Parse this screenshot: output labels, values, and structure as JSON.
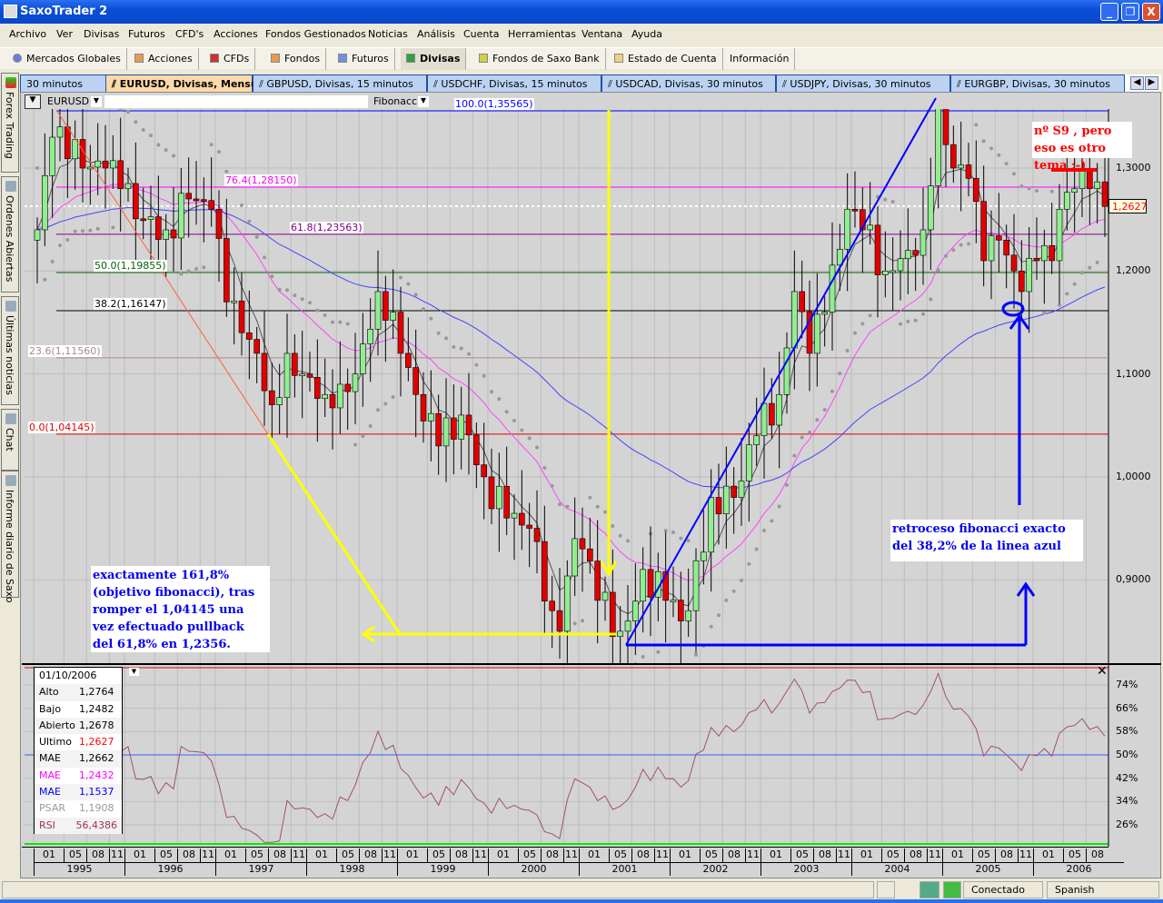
{
  "window": {
    "title": "SaxoTrader 2",
    "min": "_",
    "restore": "❐",
    "close": "X"
  },
  "menu": [
    "Archivo",
    "Ver",
    "Divisas",
    "Futuros",
    "CFD's",
    "Acciones",
    "Fondos Gestionados",
    "Noticias",
    "Análisis",
    "Cuenta",
    "Herramientas",
    "Ventana",
    "Ayuda"
  ],
  "toolbar": [
    "Mercados Globales",
    "Acciones",
    "CFDs",
    "Fondos",
    "Futuros",
    "Divisas",
    "Fondos de Saxo Bank",
    "Estado de Cuenta",
    "Información"
  ],
  "sidebar": [
    "Forex Trading",
    "Ordenes Abiertas",
    "Últimas noticias",
    "Chat",
    "Informe diario de Saxo"
  ],
  "tabs": [
    "30 minutos",
    "EURUSD, Divisas, Mensual",
    "GBPUSD, Divisas, 15 minutos",
    "USDCHF, Divisas, 15 minutos",
    "USDCAD, Divisas, 30 minutos",
    "USDJPY, Divisas, 30 minutos",
    "EURGBP, Divisas, 30 minutos"
  ],
  "chart_header": {
    "symbol": "EURUSD",
    "tool": "Fibonacci"
  },
  "colors": {
    "up": "#90ee90",
    "down": "#e00000",
    "ema_fast": "#555555",
    "ema_mid": "#ff44ff",
    "ema_slow": "#4444ff",
    "psar": "#999999",
    "rsi": "#a05070"
  },
  "chart_data": {
    "type": "candlestick",
    "symbol": "EURUSD",
    "period": "Mensual",
    "ylim": [
      0.8,
      1.37
    ],
    "y_ticks": [
      "1,3000",
      "1,2000",
      "1,1000",
      "1,0000",
      "0,9000"
    ],
    "y_tick_values": [
      1.3,
      1.2,
      1.1,
      1.0,
      0.9
    ],
    "last_price": "1,2627",
    "last_value": 1.2627,
    "month_ticks": [
      "01",
      "05",
      "08",
      "11"
    ],
    "years": [
      "1995",
      "1996",
      "1997",
      "1998",
      "1999",
      "2000",
      "2001",
      "2002",
      "2003",
      "2004",
      "2005",
      "2006"
    ],
    "close_anchors": [
      [
        "1995-01",
        1.24
      ],
      [
        "1995-03",
        1.33
      ],
      [
        "1995-04",
        1.34
      ],
      [
        "1995-07",
        1.3
      ],
      [
        "1995-10",
        1.3
      ],
      [
        "1995-12",
        1.28
      ],
      [
        "1996-03",
        1.25
      ],
      [
        "1996-06",
        1.24
      ],
      [
        "1996-09",
        1.27
      ],
      [
        "1996-12",
        1.26
      ],
      [
        "1997-02",
        1.17
      ],
      [
        "1997-04",
        1.14
      ],
      [
        "1997-06",
        1.12
      ],
      [
        "1997-08",
        1.07
      ],
      [
        "1997-10",
        1.12
      ],
      [
        "1997-12",
        1.1
      ],
      [
        "1998-03",
        1.08
      ],
      [
        "1998-05",
        1.09
      ],
      [
        "1998-07",
        1.1
      ],
      [
        "1998-10",
        1.18
      ],
      [
        "1998-12",
        1.16
      ],
      [
        "1999-01",
        1.12
      ],
      [
        "1999-03",
        1.08
      ],
      [
        "1999-06",
        1.03
      ],
      [
        "1999-09",
        1.06
      ],
      [
        "1999-12",
        1.0
      ],
      [
        "2000-03",
        0.96
      ],
      [
        "2000-06",
        0.95
      ],
      [
        "2000-09",
        0.87
      ],
      [
        "2000-10",
        0.85
      ],
      [
        "2000-12",
        0.94
      ],
      [
        "2001-01",
        0.93
      ],
      [
        "2001-03",
        0.88
      ],
      [
        "2001-06",
        0.85
      ],
      [
        "2001-07",
        0.86
      ],
      [
        "2001-09",
        0.91
      ],
      [
        "2001-12",
        0.88
      ],
      [
        "2002-02",
        0.86
      ],
      [
        "2002-03",
        0.87
      ],
      [
        "2002-06",
        0.98
      ],
      [
        "2002-09",
        0.98
      ],
      [
        "2002-12",
        1.04
      ],
      [
        "2003-03",
        1.08
      ],
      [
        "2003-05",
        1.18
      ],
      [
        "2003-07",
        1.12
      ],
      [
        "2003-09",
        1.16
      ],
      [
        "2003-12",
        1.26
      ],
      [
        "2004-02",
        1.24
      ],
      [
        "2004-05",
        1.2
      ],
      [
        "2004-08",
        1.22
      ],
      [
        "2004-10",
        1.24
      ],
      [
        "2004-12",
        1.36
      ],
      [
        "2005-02",
        1.3
      ],
      [
        "2005-04",
        1.29
      ],
      [
        "2005-06",
        1.21
      ],
      [
        "2005-08",
        1.23
      ],
      [
        "2005-10",
        1.2
      ],
      [
        "2005-11",
        1.18
      ],
      [
        "2006-01",
        1.21
      ],
      [
        "2006-03",
        1.21
      ],
      [
        "2006-04",
        1.26
      ],
      [
        "2006-06",
        1.28
      ],
      [
        "2006-08",
        1.28
      ],
      [
        "2006-10",
        1.2627
      ]
    ],
    "fibonacci": [
      {
        "label": "100.0(1,35565)",
        "value": 1.35565,
        "color": "#0000ff"
      },
      {
        "label": "76.4(1,28150)",
        "value": 1.2815,
        "color": "#ff00ff"
      },
      {
        "label": "61.8(1,23563)",
        "value": 1.23563,
        "color": "#800080"
      },
      {
        "label": "50.0(1,19855)",
        "value": 1.19855,
        "color": "#006400"
      },
      {
        "label": "38.2(1,16147)",
        "value": 1.16147,
        "color": "#000000"
      },
      {
        "label": "23.6(1,11560)",
        "value": 1.1156,
        "color": "#b08888"
      },
      {
        "label": "0.0(1,04145)",
        "value": 1.04145,
        "color": "#e00000"
      }
    ],
    "rsi": {
      "y_ticks": [
        "74%",
        "66%",
        "58%",
        "50%",
        "42%",
        "34%",
        "26%"
      ],
      "y_values": [
        74,
        66,
        58,
        50,
        42,
        34,
        26
      ],
      "last": 56.4386
    }
  },
  "annotations": {
    "top_right": "nº S9 , pero eso es otro tema ;-)",
    "right": "retroceso fibonacci exacto del 38,2% de la linea azul",
    "left": "exactamente 161,8% (objetivo fibonacci), tras romper el 1,04145 una vez efectuado pullback del 61,8% en 1,2356."
  },
  "tooltip": {
    "date": "01/10/2006",
    "rows": [
      {
        "label": "Alto",
        "value": "1,2764",
        "color": "#000"
      },
      {
        "label": "Bajo",
        "value": "1,2482",
        "color": "#000"
      },
      {
        "label": "Abierto",
        "value": "1,2678",
        "color": "#000"
      },
      {
        "label": "Ultimo",
        "value": "1,2627",
        "color": "#ff0000",
        "lcolor": "#000"
      },
      {
        "label": "MAE",
        "value": "1,2662",
        "color": "#000"
      },
      {
        "label": "MAE",
        "value": "1,2432",
        "color": "#ff00ff"
      },
      {
        "label": "MAE",
        "value": "1,1537",
        "color": "#0000ff"
      },
      {
        "label": "PSAR",
        "value": "1,1908",
        "color": "#999999"
      },
      {
        "label": "RSI",
        "value": "56,4386",
        "color": "#a03060"
      }
    ]
  },
  "status": {
    "connection": "Conectado",
    "language": "Spanish"
  }
}
